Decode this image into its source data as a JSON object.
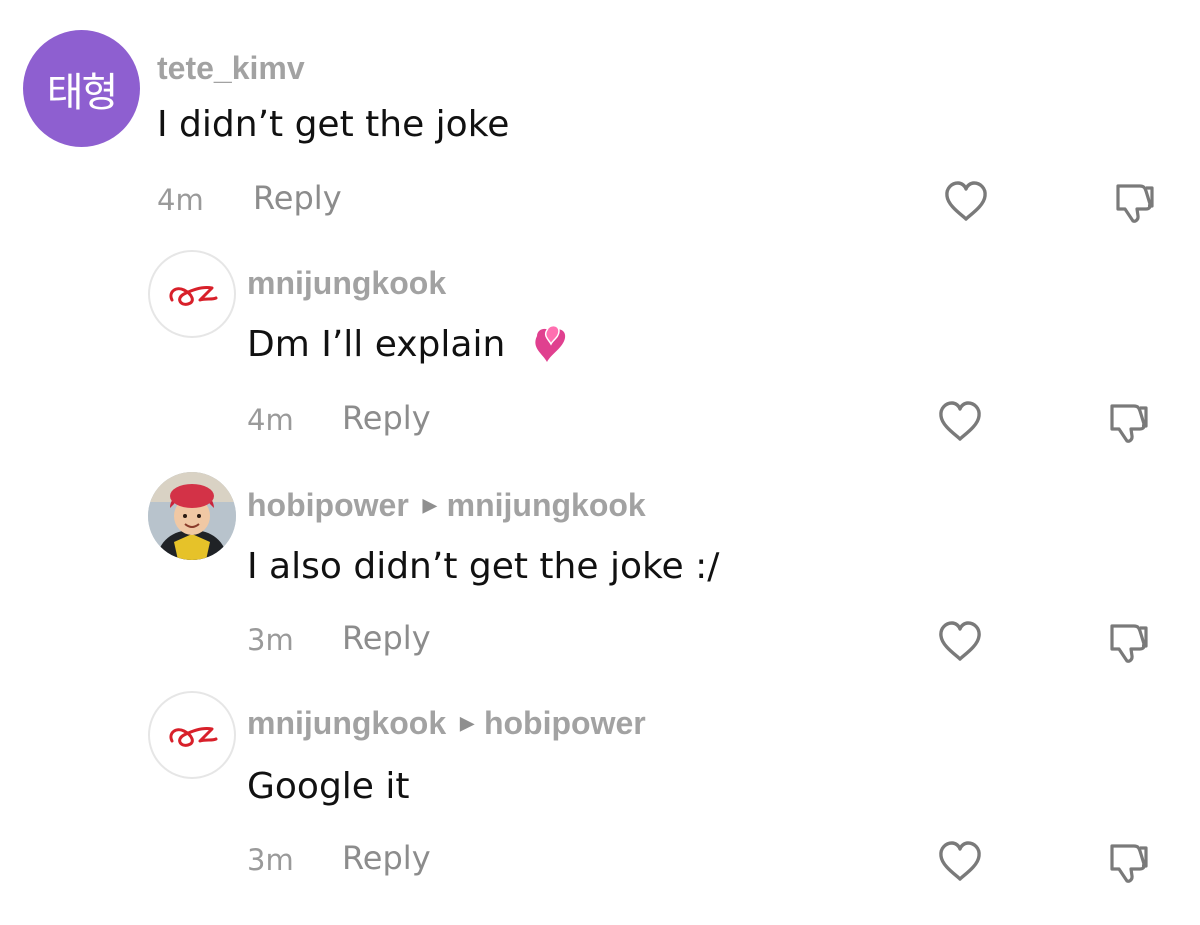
{
  "comments": [
    {
      "avatar_text": "태형",
      "avatar_icon": "korean-initials-avatar",
      "username": "tete_kimv",
      "reply_to": "",
      "text": "I didn’t get the joke",
      "time": "4m",
      "reply_label": "Reply"
    },
    {
      "avatar_icon": "red-swirl-logo-avatar",
      "username": "mnijungkook",
      "reply_to": "",
      "text": "Dm I’ll explain",
      "emoji": "two-hearts-emoji",
      "time": "4m",
      "reply_label": "Reply"
    },
    {
      "avatar_icon": "child-in-red-helmet-photo-avatar",
      "username": "hobipower",
      "reply_to": "mnijungkook",
      "text": "I also didn’t get the joke :/",
      "time": "3m",
      "reply_label": "Reply"
    },
    {
      "avatar_icon": "red-swirl-logo-avatar",
      "username": "mnijungkook",
      "reply_to": "hobipower",
      "text": "Google it",
      "time": "3m",
      "reply_label": "Reply"
    }
  ],
  "colors": {
    "username": "#a2a2a2",
    "text": "#111111",
    "meta": "#9a9a9a",
    "avatar_purple": "#8e5fd0",
    "logo_red": "#d8202a"
  }
}
